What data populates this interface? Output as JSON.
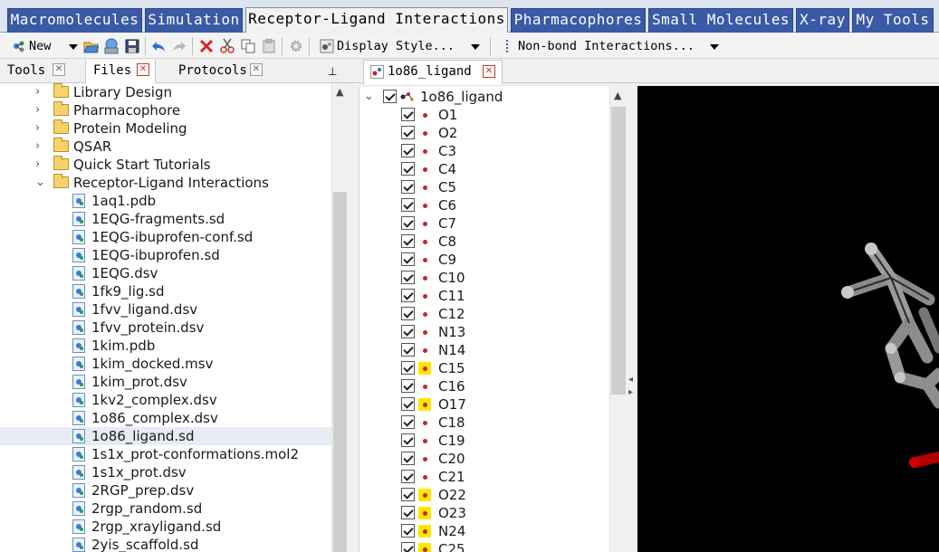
{
  "top_tabs": [
    {
      "label": "Macromolecules",
      "active": false
    },
    {
      "label": "Simulation",
      "active": false
    },
    {
      "label": "Receptor-Ligand Interactions",
      "active": true
    },
    {
      "label": "Pharmacophores",
      "active": false
    },
    {
      "label": "Small Molecules",
      "active": false
    },
    {
      "label": "X-ray",
      "active": false
    },
    {
      "label": "My Tools",
      "active": false
    }
  ],
  "toolbar": {
    "new_label": "New",
    "display_style_label": "Display Style...",
    "nonbond_label": "Non-bond Interactions..."
  },
  "left_tabs": [
    {
      "label": "Tools",
      "active": false
    },
    {
      "label": "Files",
      "active": true
    },
    {
      "label": "Protocols",
      "active": false
    }
  ],
  "file_tree": [
    {
      "label": "Library Design",
      "type": "folder",
      "expanded": false
    },
    {
      "label": "Pharmacophore",
      "type": "folder",
      "expanded": false
    },
    {
      "label": "Protein Modeling",
      "type": "folder",
      "expanded": false
    },
    {
      "label": "QSAR",
      "type": "folder",
      "expanded": false
    },
    {
      "label": "Quick Start Tutorials",
      "type": "folder",
      "expanded": false
    },
    {
      "label": "Receptor-Ligand Interactions",
      "type": "folder",
      "expanded": true
    },
    {
      "label": "1aq1.pdb",
      "type": "file"
    },
    {
      "label": "1EQG-fragments.sd",
      "type": "file"
    },
    {
      "label": "1EQG-ibuprofen-conf.sd",
      "type": "file"
    },
    {
      "label": "1EQG-ibuprofen.sd",
      "type": "file"
    },
    {
      "label": "1EQG.dsv",
      "type": "file"
    },
    {
      "label": "1fk9_lig.sd",
      "type": "file"
    },
    {
      "label": "1fvv_ligand.dsv",
      "type": "file"
    },
    {
      "label": "1fvv_protein.dsv",
      "type": "file"
    },
    {
      "label": "1kim.pdb",
      "type": "file"
    },
    {
      "label": "1kim_docked.msv",
      "type": "file"
    },
    {
      "label": "1kim_prot.dsv",
      "type": "file"
    },
    {
      "label": "1kv2_complex.dsv",
      "type": "file"
    },
    {
      "label": "1o86_complex.dsv",
      "type": "file"
    },
    {
      "label": "1o86_ligand.sd",
      "type": "file",
      "selected": true
    },
    {
      "label": "1s1x_prot-conformations.mol2",
      "type": "file"
    },
    {
      "label": "1s1x_prot.dsv",
      "type": "file"
    },
    {
      "label": "2RGP_prep.dsv",
      "type": "file"
    },
    {
      "label": "2rgp_random.sd",
      "type": "file"
    },
    {
      "label": "2rgp_xrayligand.sd",
      "type": "file"
    },
    {
      "label": "2yis_scaffold.sd",
      "type": "file"
    }
  ],
  "document_tab": {
    "label": "1o86_ligand"
  },
  "molecule": {
    "name": "1o86_ligand",
    "atoms": [
      {
        "label": "O1",
        "highlight": false
      },
      {
        "label": "O2",
        "highlight": false
      },
      {
        "label": "C3",
        "highlight": false
      },
      {
        "label": "C4",
        "highlight": false
      },
      {
        "label": "C5",
        "highlight": false
      },
      {
        "label": "C6",
        "highlight": false
      },
      {
        "label": "C7",
        "highlight": false
      },
      {
        "label": "C8",
        "highlight": false
      },
      {
        "label": "C9",
        "highlight": false
      },
      {
        "label": "C10",
        "highlight": false
      },
      {
        "label": "C11",
        "highlight": false
      },
      {
        "label": "C12",
        "highlight": false
      },
      {
        "label": "N13",
        "highlight": false
      },
      {
        "label": "N14",
        "highlight": false
      },
      {
        "label": "C15",
        "highlight": true
      },
      {
        "label": "C16",
        "highlight": false
      },
      {
        "label": "O17",
        "highlight": true
      },
      {
        "label": "C18",
        "highlight": false
      },
      {
        "label": "C19",
        "highlight": false
      },
      {
        "label": "C20",
        "highlight": false
      },
      {
        "label": "C21",
        "highlight": false
      },
      {
        "label": "O22",
        "highlight": true
      },
      {
        "label": "O23",
        "highlight": true
      },
      {
        "label": "N24",
        "highlight": true
      },
      {
        "label": "C25",
        "highlight": true
      }
    ]
  },
  "colors": {
    "tab_blue": "#3a5aa6",
    "highlight_yellow": "#ffe600",
    "atom_red": "#c0282d",
    "viewer_bg": "#000000"
  }
}
